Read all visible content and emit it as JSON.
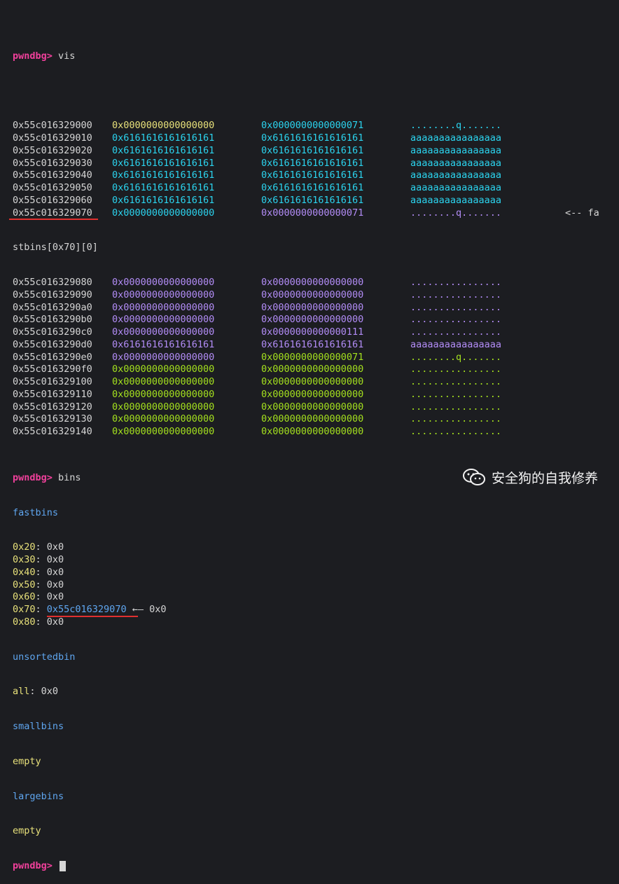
{
  "prompt": "pwndbg>",
  "cursor": "▮",
  "prev_command": "vis",
  "bins_command": "bins",
  "memory_rows": [
    {
      "addr": "0x55c016329000",
      "q1": "0x0000000000000000",
      "q2": "0x0000000000000071",
      "ascii": "........q.......",
      "c1": "yellow",
      "c2": "cyan",
      "c3": "cyan"
    },
    {
      "addr": "0x55c016329010",
      "q1": "0x6161616161616161",
      "q2": "0x6161616161616161",
      "ascii": "aaaaaaaaaaaaaaaa",
      "c1": "cyan",
      "c2": "cyan",
      "c3": "cyan"
    },
    {
      "addr": "0x55c016329020",
      "q1": "0x6161616161616161",
      "q2": "0x6161616161616161",
      "ascii": "aaaaaaaaaaaaaaaa",
      "c1": "cyan",
      "c2": "cyan",
      "c3": "cyan"
    },
    {
      "addr": "0x55c016329030",
      "q1": "0x6161616161616161",
      "q2": "0x6161616161616161",
      "ascii": "aaaaaaaaaaaaaaaa",
      "c1": "cyan",
      "c2": "cyan",
      "c3": "cyan"
    },
    {
      "addr": "0x55c016329040",
      "q1": "0x6161616161616161",
      "q2": "0x6161616161616161",
      "ascii": "aaaaaaaaaaaaaaaa",
      "c1": "cyan",
      "c2": "cyan",
      "c3": "cyan"
    },
    {
      "addr": "0x55c016329050",
      "q1": "0x6161616161616161",
      "q2": "0x6161616161616161",
      "ascii": "aaaaaaaaaaaaaaaa",
      "c1": "cyan",
      "c2": "cyan",
      "c3": "cyan"
    },
    {
      "addr": "0x55c016329060",
      "q1": "0x6161616161616161",
      "q2": "0x6161616161616161",
      "ascii": "aaaaaaaaaaaaaaaa",
      "c1": "cyan",
      "c2": "cyan",
      "c3": "cyan"
    },
    {
      "addr": "0x55c016329070",
      "q1": "0x0000000000000000",
      "q2": "0x0000000000000071",
      "ascii": "........q.......",
      "c1": "cyan",
      "c2": "purple",
      "c3": "purple",
      "note": "<-- fa",
      "highlight": true
    }
  ],
  "wrap_line": "stbins[0x70][0]",
  "memory_rows_2": [
    {
      "addr": "0x55c016329080",
      "q1": "0x0000000000000000",
      "q2": "0x0000000000000000",
      "ascii": "................",
      "c1": "purple",
      "c2": "purple",
      "c3": "purple"
    },
    {
      "addr": "0x55c016329090",
      "q1": "0x0000000000000000",
      "q2": "0x0000000000000000",
      "ascii": "................",
      "c1": "purple",
      "c2": "purple",
      "c3": "purple"
    },
    {
      "addr": "0x55c0163290a0",
      "q1": "0x0000000000000000",
      "q2": "0x0000000000000000",
      "ascii": "................",
      "c1": "purple",
      "c2": "purple",
      "c3": "purple"
    },
    {
      "addr": "0x55c0163290b0",
      "q1": "0x0000000000000000",
      "q2": "0x0000000000000000",
      "ascii": "................",
      "c1": "purple",
      "c2": "purple",
      "c3": "purple"
    },
    {
      "addr": "0x55c0163290c0",
      "q1": "0x0000000000000000",
      "q2": "0x0000000000000111",
      "ascii": "................",
      "c1": "purple",
      "c2": "purple",
      "c3": "purple"
    },
    {
      "addr": "0x55c0163290d0",
      "q1": "0x6161616161616161",
      "q2": "0x6161616161616161",
      "ascii": "aaaaaaaaaaaaaaaa",
      "c1": "purple",
      "c2": "purple",
      "c3": "purple"
    },
    {
      "addr": "0x55c0163290e0",
      "q1": "0x0000000000000000",
      "q2": "0x0000000000000071",
      "ascii": "........q.......",
      "c1": "purple",
      "c2": "green",
      "c3": "green"
    },
    {
      "addr": "0x55c0163290f0",
      "q1": "0x0000000000000000",
      "q2": "0x0000000000000000",
      "ascii": "................",
      "c1": "green",
      "c2": "green",
      "c3": "green"
    },
    {
      "addr": "0x55c016329100",
      "q1": "0x0000000000000000",
      "q2": "0x0000000000000000",
      "ascii": "................",
      "c1": "green",
      "c2": "green",
      "c3": "green"
    },
    {
      "addr": "0x55c016329110",
      "q1": "0x0000000000000000",
      "q2": "0x0000000000000000",
      "ascii": "................",
      "c1": "green",
      "c2": "green",
      "c3": "green"
    },
    {
      "addr": "0x55c016329120",
      "q1": "0x0000000000000000",
      "q2": "0x0000000000000000",
      "ascii": "................",
      "c1": "green",
      "c2": "green",
      "c3": "green"
    },
    {
      "addr": "0x55c016329130",
      "q1": "0x0000000000000000",
      "q2": "0x0000000000000000",
      "ascii": "................",
      "c1": "green",
      "c2": "green",
      "c3": "green"
    },
    {
      "addr": "0x55c016329140",
      "q1": "0x0000000000000000",
      "q2": "0x0000000000000000",
      "ascii": "................",
      "c1": "green",
      "c2": "green",
      "c3": "green"
    }
  ],
  "bins_output": {
    "fastbins_label": "fastbins",
    "fastbins": [
      {
        "size": "0x20",
        "value": "0x0"
      },
      {
        "size": "0x30",
        "value": "0x0"
      },
      {
        "size": "0x40",
        "value": "0x0"
      },
      {
        "size": "0x50",
        "value": "0x0"
      },
      {
        "size": "0x60",
        "value": "0x0"
      },
      {
        "size": "0x70",
        "value": "0x55c016329070",
        "arrow": "←— 0x0"
      },
      {
        "size": "0x80",
        "value": "0x0"
      }
    ],
    "unsorted_label": "unsortedbin",
    "unsorted": {
      "key": "all",
      "value": "0x0"
    },
    "smallbins_label": "smallbins",
    "smallbins_value": "empty",
    "largebins_label": "largebins",
    "largebins_value": "empty"
  },
  "watermark": {
    "text": "安全狗的自我修养",
    "icon": "wechat-icon"
  },
  "colors": {
    "prompt": "#f0409b",
    "yellow": "#e7e07a",
    "cyan": "#2bd3ee",
    "purple": "#b28cf6",
    "green": "#a4e01e",
    "blue": "#5fa6f0",
    "underline": "#e0302f",
    "background": "#1c1d21"
  }
}
